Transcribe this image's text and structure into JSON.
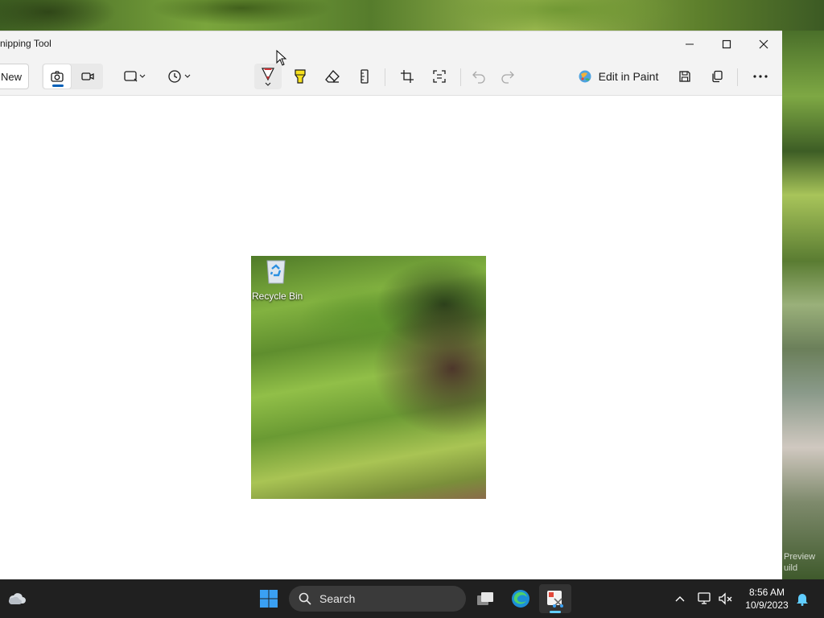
{
  "window": {
    "title": "nipping Tool",
    "minimize_icon": "minimize-icon",
    "maximize_icon": "maximize-icon",
    "close_icon": "close-icon"
  },
  "toolbar": {
    "new_label": "New",
    "snip_mode_icon": "camera-icon",
    "record_mode_icon": "video-icon",
    "shape_icon": "rectangle-snip-icon",
    "delay_icon": "clock-icon",
    "pen_icon": "ballpoint-pen-icon",
    "highlighter_icon": "highlighter-icon",
    "eraser_icon": "eraser-icon",
    "ruler_icon": "ruler-icon",
    "crop_icon": "crop-icon",
    "text_actions_icon": "text-actions-icon",
    "undo_icon": "undo-icon",
    "redo_icon": "redo-icon",
    "edit_in_paint_label": "Edit in Paint",
    "save_icon": "save-icon",
    "copy_icon": "copy-icon",
    "more_icon": "more-icon"
  },
  "snip": {
    "desktop_icon_label": "Recycle Bin"
  },
  "desktop": {
    "watermark_line1": "Preview",
    "watermark_line2": "uild"
  },
  "taskbar": {
    "search_label": "Search",
    "time": "8:56 AM",
    "date": "10/9/2023"
  },
  "colors": {
    "accent": "#005fb8",
    "taskbar_bg": "#202020",
    "taskbar_indicator": "#60cdff",
    "pen_red": "#d13438",
    "highlighter_yellow": "#f7e11e"
  }
}
